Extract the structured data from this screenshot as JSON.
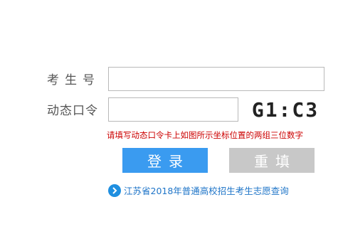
{
  "form": {
    "candidate_id_label": "考生号",
    "candidate_id_value": "",
    "dynamic_code_label": "动态口令",
    "dynamic_code_value": "",
    "captcha_text": "G1:C3",
    "hint": "请填写动态口令卡上如图所示坐标位置的两组三位数字"
  },
  "buttons": {
    "login_label": "登录",
    "reset_label": "重填"
  },
  "footer_link": {
    "icon": "chevron-right-circle-icon",
    "text": "江苏省2018年普通高校招生考生志愿查询"
  },
  "colors": {
    "login_button": "#3a9bf0",
    "reset_button": "#c8c8c8",
    "hint_text": "#cc0000",
    "link_text": "#1f75c8"
  }
}
